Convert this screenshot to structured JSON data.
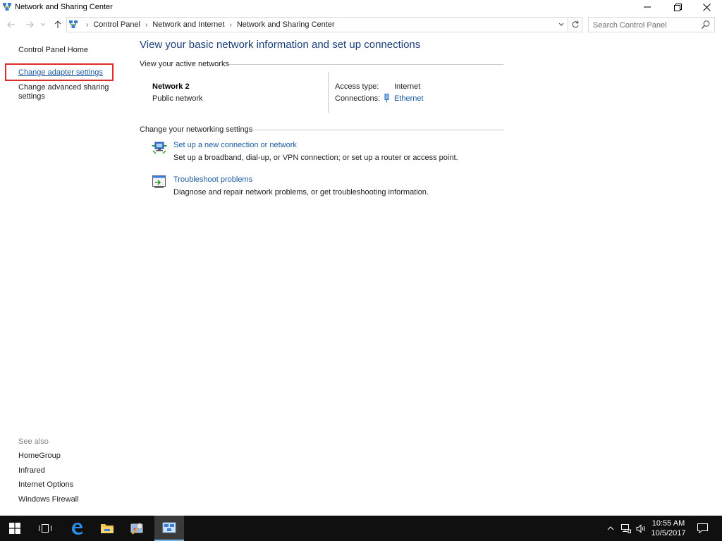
{
  "window": {
    "title": "Network and Sharing Center",
    "controls": {
      "minimize": "minimize",
      "restore": "restore",
      "close": "close"
    }
  },
  "nav": {
    "breadcrumbs": [
      "Control Panel",
      "Network and Internet",
      "Network and Sharing Center"
    ],
    "search_placeholder": "Search Control Panel"
  },
  "left_pane": {
    "home": "Control Panel Home",
    "change_adapter": "Change adapter settings",
    "change_sharing_line1": "Change advanced sharing",
    "change_sharing_line2": "settings",
    "see_also_label": "See also",
    "see_also": [
      "HomeGroup",
      "Infrared",
      "Internet Options",
      "Windows Firewall"
    ]
  },
  "main": {
    "headline": "View your basic network information and set up connections",
    "active_networks_label": "View your active networks",
    "network_name": "Network  2",
    "network_type": "Public network",
    "access_type_label": "Access type:",
    "access_type_value": "Internet",
    "connections_label": "Connections:",
    "connections_value": "Ethernet",
    "change_settings_label": "Change your networking settings",
    "tasks": [
      {
        "title": "Set up a new connection or network",
        "desc": "Set up a broadband, dial-up, or VPN connection; or set up a router or access point.",
        "icon": "network-setup-icon"
      },
      {
        "title": "Troubleshoot problems",
        "desc": "Diagnose and repair network problems, or get troubleshooting information.",
        "icon": "troubleshoot-icon"
      }
    ]
  },
  "taskbar": {
    "time": "10:55 AM",
    "date": "10/5/2017",
    "items": [
      "start-icon",
      "task-view-icon",
      "edge-icon",
      "file-explorer-icon",
      "control-panel-app-icon",
      "network-center-app-icon"
    ]
  },
  "colors": {
    "link": "#1a5aa0",
    "headline": "#1a3e79",
    "highlight": "#e02b2b",
    "taskbar": "#101010"
  }
}
